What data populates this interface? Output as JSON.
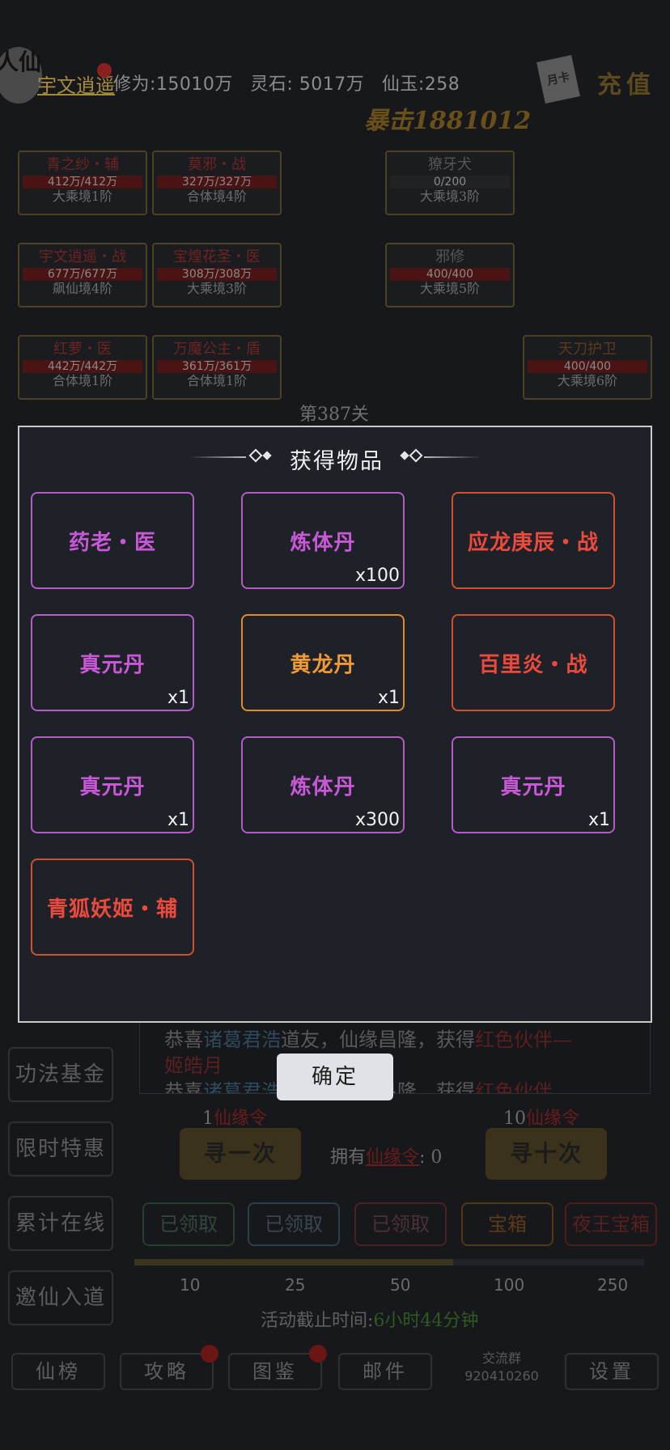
{
  "top": {
    "avatar": "人仙",
    "name": "宇文逍遥",
    "cultivation": "修为:15010万",
    "spirit_stone": "灵石: 5017万",
    "jade": "仙玉:258",
    "month_card": "月卡",
    "recharge": "充值",
    "crit": "暴击1881012"
  },
  "party": [
    {
      "name": "青之纱・辅",
      "hp": "412万/412万",
      "rank": "大乘境1阶"
    },
    {
      "name": "莫邪・战",
      "hp": "327万/327万",
      "rank": "合体境4阶"
    },
    {
      "name": "宇文逍遥・战",
      "hp": "677万/677万",
      "rank": "飙仙境4阶"
    },
    {
      "name": "宝煌花圣・医",
      "hp": "308万/308万",
      "rank": "大乘境3阶"
    },
    {
      "name": "红萝・医",
      "hp": "442万/442万",
      "rank": "合体境1阶"
    },
    {
      "name": "万魔公主・盾",
      "hp": "361万/361万",
      "rank": "合体境1阶"
    }
  ],
  "enemies": [
    {
      "name": "獠牙犬",
      "hp": "0/200",
      "rank": "大乘境3阶"
    },
    {
      "name": "邪修",
      "hp": "400/400",
      "rank": "大乘境5阶"
    },
    {
      "name": "天刀护卫",
      "hp": "400/400",
      "rank": "大乘境6阶"
    }
  ],
  "stage": "第387关",
  "side_menu": [
    "功法基金",
    "限时特惠",
    "累计在线",
    "邀仙入道"
  ],
  "announcement": {
    "line1_prefix": "恭喜",
    "line1_name": "诸葛君浩",
    "line1_mid": "道友，仙缘昌隆，获得",
    "line1_reward": "红色伙伴—",
    "line2": "姬皓月",
    "line3_prefix": "恭喜",
    "line3_name": "诸葛君浩",
    "line3_mid": "道友，仙缘昌隆，获得",
    "line3_reward": "红色伙伴"
  },
  "gacha": {
    "one_cost_num": "1",
    "one_cost_unit": "仙缘令",
    "ten_cost_num": "10",
    "ten_cost_unit": "仙缘令",
    "seek_one": "寻一次",
    "seek_ten": "寻十次",
    "own_label": "拥有",
    "own_item": "仙缘令",
    "own_count": ": 0"
  },
  "milestones": [
    {
      "label": "已领取",
      "value": "10"
    },
    {
      "label": "已领取",
      "value": "25"
    },
    {
      "label": "已领取",
      "value": "50"
    },
    {
      "label": "宝箱",
      "value": "100"
    },
    {
      "label": "夜王宝箱",
      "value": "250"
    }
  ],
  "milestone_progress": 0.625,
  "deadline_label": "活动截止时间:",
  "deadline_value": "6小时44分钟",
  "bottom_nav": [
    "仙榜",
    "攻略",
    "图鉴",
    "邮件",
    "设置"
  ],
  "group": {
    "label": "交流群",
    "number": "920410260"
  },
  "modal": {
    "title": "获得物品",
    "confirm": "确定",
    "items": [
      {
        "name": "药老・医",
        "qty": "",
        "quality": "purple"
      },
      {
        "name": "炼体丹",
        "qty": "x100",
        "quality": "purple"
      },
      {
        "name": "应龙庚辰・战",
        "qty": "",
        "quality": "red"
      },
      {
        "name": "真元丹",
        "qty": "x1",
        "quality": "purple"
      },
      {
        "name": "黄龙丹",
        "qty": "x1",
        "quality": "orange"
      },
      {
        "name": "百里炎・战",
        "qty": "",
        "quality": "red"
      },
      {
        "name": "真元丹",
        "qty": "x1",
        "quality": "purple"
      },
      {
        "name": "炼体丹",
        "qty": "x300",
        "quality": "purple"
      },
      {
        "name": "真元丹",
        "qty": "x1",
        "quality": "purple"
      },
      {
        "name": "青狐妖姬・辅",
        "qty": "",
        "quality": "red"
      }
    ]
  },
  "colors": {
    "purple": "#c858d6",
    "orange": "#f09a36",
    "red": "#ec4a3c",
    "modal_bg": "#1e2128",
    "green_time": "#2e5a22"
  }
}
